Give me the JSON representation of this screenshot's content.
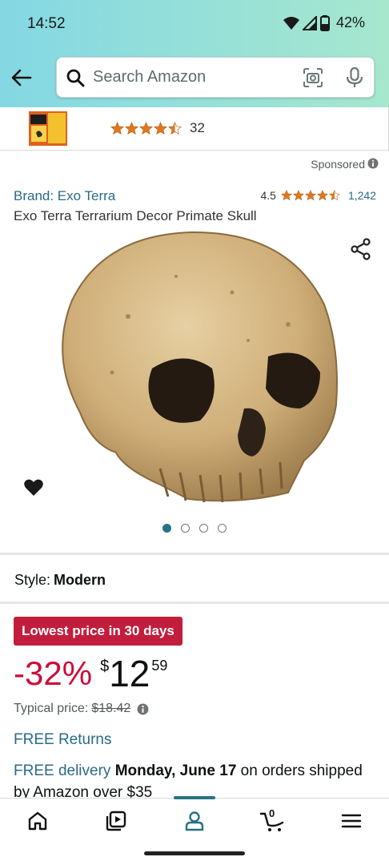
{
  "status_bar": {
    "time": "14:52",
    "battery": "42%"
  },
  "search": {
    "placeholder": "Search Amazon"
  },
  "sponsored_strip": {
    "rating_count": "32",
    "stars": 4.5
  },
  "sponsored_label": "Sponsored",
  "product": {
    "brand": "Brand: Exo Terra",
    "rating_value": "4.5",
    "rating_count": "1,242",
    "title": "Exo Terra Terrarium Decor Primate Skull",
    "image_pages": 4,
    "active_image": 1
  },
  "style": {
    "label": "Style:",
    "value": "Modern"
  },
  "deal": {
    "badge": "Lowest price in 30 days",
    "discount": "-32%",
    "currency": "$",
    "whole": "12",
    "fraction": "59",
    "typical_label": "Typical price:",
    "typical_price": "$18.42"
  },
  "shipping": {
    "free_returns": "FREE Returns",
    "free_delivery": "FREE delivery",
    "date": "Monday, June 17",
    "rest": "on orders shipped by Amazon over $35"
  },
  "bottom_nav": {
    "cart_count": "0"
  },
  "colors": {
    "link": "#2a6b86",
    "deal_red": "#c21d3c",
    "discount_red": "#cc0c39",
    "star": "#de7921",
    "accent": "#257384"
  }
}
